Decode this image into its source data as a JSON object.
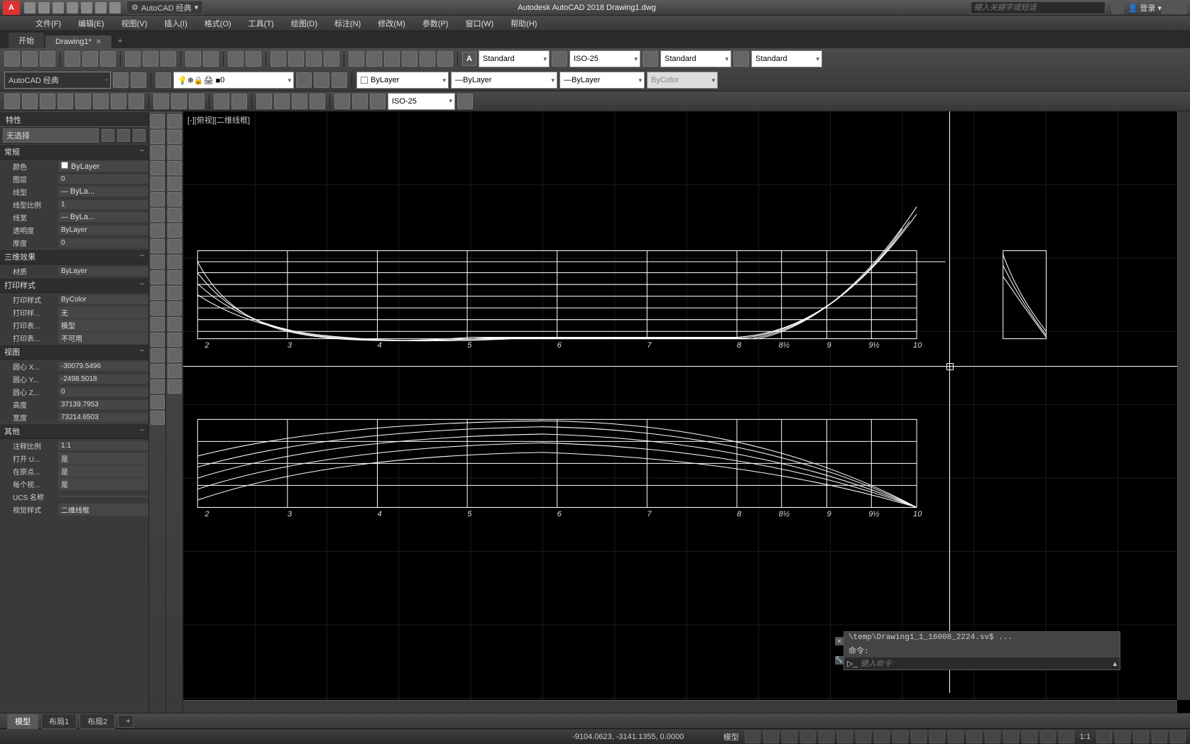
{
  "app": {
    "title": "Autodesk AutoCAD 2018   Drawing1.dwg",
    "logo": "A"
  },
  "search_placeholder": "键入关键字或短语",
  "login_label": "登录",
  "workspace_dd": "AutoCAD 经典",
  "menu": [
    "文件(F)",
    "编辑(E)",
    "视图(V)",
    "插入(I)",
    "格式(O)",
    "工具(T)",
    "绘图(D)",
    "标注(N)",
    "修改(M)",
    "参数(P)",
    "窗口(W)",
    "帮助(H)"
  ],
  "tabs": {
    "start": "开始",
    "file": "Drawing1*",
    "add": "+"
  },
  "styles": {
    "text": "Standard",
    "dim": "ISO-25",
    "table": "Standard",
    "ml": "Standard"
  },
  "layer": {
    "current": "0"
  },
  "linetype_dd": "ByLayer",
  "lineweight_dd": "ByLayer",
  "plotstyle_dd": "ByColor",
  "color_dd": "ByLayer",
  "workspace_select": "AutoCAD 经典",
  "dimstyle_row3": "ISO-25",
  "viewport_label": "[-][俯视][二维线框]",
  "props": {
    "title": "特性",
    "selection": "无选择",
    "groups": {
      "general": {
        "label": "常规",
        "color_l": "颜色",
        "color_v": "ByLayer",
        "layer_l": "图层",
        "layer_v": "0",
        "ltype_l": "线型",
        "ltype_v": "ByLa...",
        "ltscale_l": "线型比例",
        "ltscale_v": "1",
        "lweight_l": "线宽",
        "lweight_v": "ByLa...",
        "transp_l": "透明度",
        "transp_v": "ByLayer",
        "thick_l": "厚度",
        "thick_v": "0"
      },
      "threeD": {
        "label": "三维效果",
        "mat_l": "材质",
        "mat_v": "ByLayer"
      },
      "plot": {
        "label": "打印样式",
        "ps_l": "打印样式",
        "ps_v": "ByColor",
        "ps2_l": "打印样...",
        "ps2_v": "无",
        "ps3_l": "打印表...",
        "ps3_v": "模型",
        "ps4_l": "打印表...",
        "ps4_v": "不可用"
      },
      "view": {
        "label": "视图",
        "cx_l": "圆心 X...",
        "cx_v": "-30079.5496",
        "cy_l": "圆心 Y...",
        "cy_v": "-2498.5018",
        "cz_l": "圆心 Z...",
        "cz_v": "0",
        "h_l": "高度",
        "h_v": "37139.7953",
        "w_l": "宽度",
        "w_v": "73214.6503"
      },
      "misc": {
        "label": "其他",
        "as_l": "注释比例",
        "as_v": "1:1",
        "ou_l": "打开 U...",
        "ou_v": "是",
        "op_l": "在原点...",
        "op_v": "是",
        "pv_l": "每个视...",
        "pv_v": "是",
        "ucs_l": "UCS 名称",
        "ucs_v": "",
        "vs_l": "视觉样式",
        "vs_v": "二维线框"
      }
    }
  },
  "cmd": {
    "history_line": "\\temp\\Drawing1_1_16008_2224.sv$ ...",
    "prompt": "命令:",
    "placeholder": "键入命令"
  },
  "bottomtabs": {
    "model": "模型",
    "layout1": "布局1",
    "layout2": "布局2",
    "add": "+"
  },
  "status": {
    "coords": "-9104.0623, -3141.1355, 0.0000",
    "model_label": "模型",
    "scale": "1:1"
  },
  "axis_labels": [
    "2",
    "3",
    "4",
    "5",
    "6",
    "7",
    "8",
    "8½",
    "9",
    "9½",
    "10"
  ]
}
